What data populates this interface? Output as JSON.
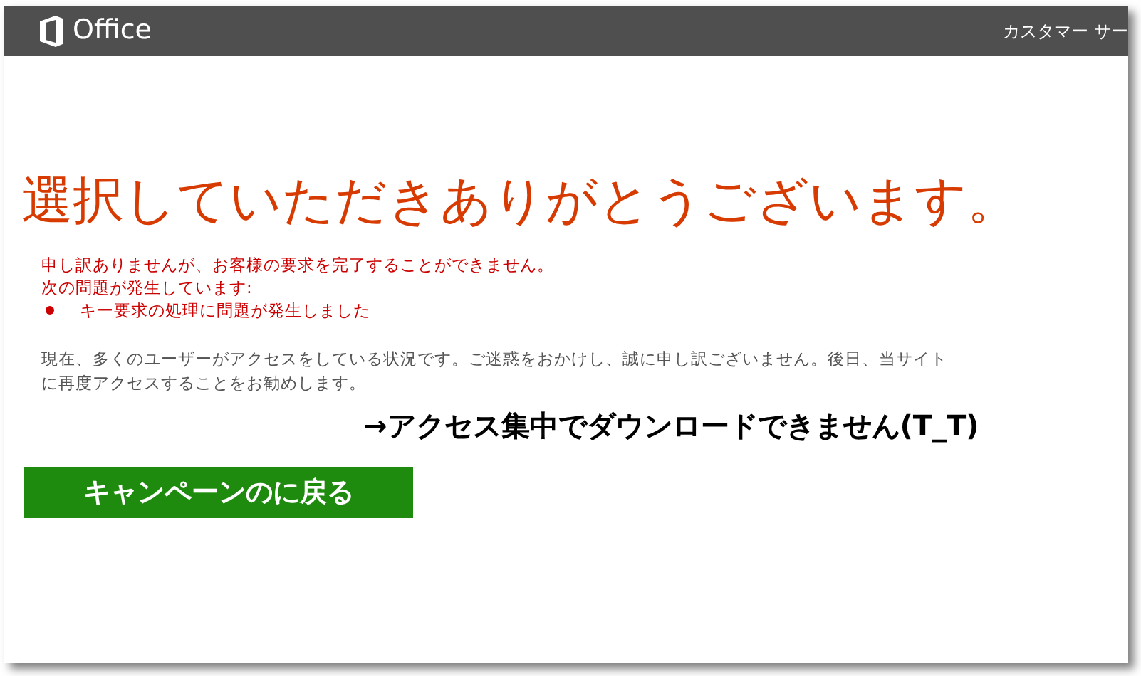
{
  "header": {
    "logo_text": "Office",
    "link": "カスタマー サー"
  },
  "title": "選択していただきありがとうございます。",
  "error": {
    "lines": [
      "申し訳ありませんが、お客様の要求を完了することができません。",
      "次の問題が発生しています:"
    ],
    "items": [
      "キー要求の処理に問題が発生しました"
    ]
  },
  "message": "現在、多くのユーザーがアクセスをしている状況です。ご迷惑をおかけし、誠に申し訳ございません。後日、当サイトに再度アクセスすることをお勧めします。",
  "annotation": "→アクセス集中でダウンロードできません(T_T)",
  "button": "キャンペーンのに戻る"
}
